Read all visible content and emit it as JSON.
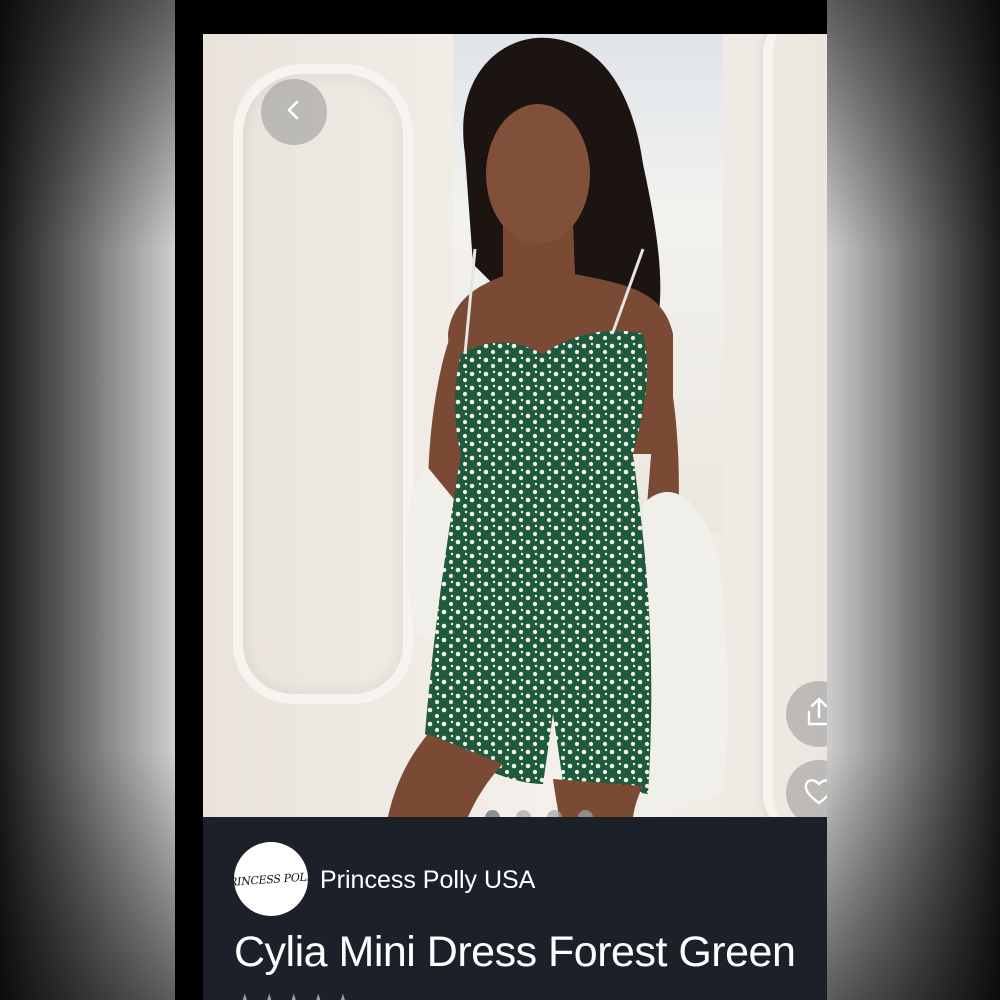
{
  "brand": {
    "name": "Princess Polly USA",
    "logo_text": "PRINCESS POLLY"
  },
  "product": {
    "title": "Cylia Mini Dress Forest Green",
    "rating_stars": "★★★★★",
    "carousel": {
      "total": 4,
      "active": 1
    }
  },
  "icons": {
    "back": "chevron-left-icon",
    "share": "share-icon",
    "like": "heart-icon"
  },
  "colors": {
    "info_background": "#1c2029",
    "dress": "#1f5a3c",
    "button_overlay": "rgba(150,150,150,0.55)"
  }
}
